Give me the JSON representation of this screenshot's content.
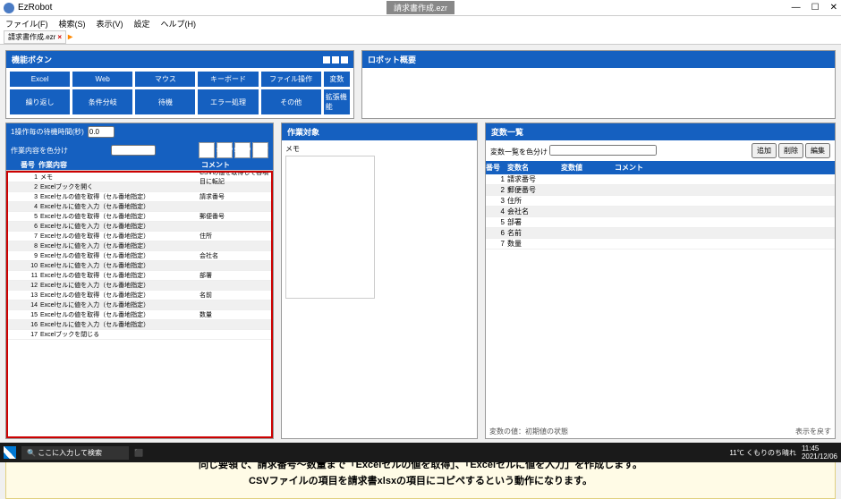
{
  "app": {
    "name": "EzRobot",
    "doc_title": "請求書作成.ezr"
  },
  "win_controls": {
    "min": "—",
    "max": "☐",
    "close": "✕"
  },
  "menu": [
    "ファイル(F)",
    "検索(S)",
    "表示(V)",
    "設定",
    "ヘルプ(H)"
  ],
  "tab": {
    "label": "請求書作成.ezr"
  },
  "func": {
    "title": "機能ボタン",
    "row1": [
      "Excel",
      "Web",
      "マウス",
      "キーボード",
      "ファイル操作",
      "変数"
    ],
    "row2": [
      "繰り返し",
      "条件分岐",
      "待機",
      "エラー処理",
      "その他",
      "拡張機能"
    ]
  },
  "robot": {
    "title": "ロボット概要"
  },
  "steps": {
    "wait_label": "1操作毎の待機時間(秒)",
    "wait_val": "0.0",
    "color_label": "作業内容を色分け",
    "hdr": [
      "",
      "番号",
      "作業内容",
      "コメント"
    ],
    "play": [
      "REC",
      "STEP",
      "STOP",
      "PLAY"
    ],
    "rows": [
      {
        "n": "1",
        "a": "メモ",
        "c": "CSVの値を取得して各項目に転記"
      },
      {
        "n": "2",
        "a": "Excelブックを開く",
        "c": ""
      },
      {
        "n": "3",
        "a": "Excelセルの値を取得（セル番地指定）",
        "c": "請求番号"
      },
      {
        "n": "4",
        "a": "Excelセルに値を入力（セル番地指定）",
        "c": ""
      },
      {
        "n": "5",
        "a": "Excelセルの値を取得（セル番地指定）",
        "c": "郵便番号"
      },
      {
        "n": "6",
        "a": "Excelセルに値を入力（セル番地指定）",
        "c": ""
      },
      {
        "n": "7",
        "a": "Excelセルの値を取得（セル番地指定）",
        "c": "住所"
      },
      {
        "n": "8",
        "a": "Excelセルに値を入力（セル番地指定）",
        "c": ""
      },
      {
        "n": "9",
        "a": "Excelセルの値を取得（セル番地指定）",
        "c": "会社名"
      },
      {
        "n": "10",
        "a": "Excelセルに値を入力（セル番地指定）",
        "c": ""
      },
      {
        "n": "11",
        "a": "Excelセルの値を取得（セル番地指定）",
        "c": "部署"
      },
      {
        "n": "12",
        "a": "Excelセルに値を入力（セル番地指定）",
        "c": ""
      },
      {
        "n": "13",
        "a": "Excelセルの値を取得（セル番地指定）",
        "c": "名前"
      },
      {
        "n": "14",
        "a": "Excelセルに値を入力（セル番地指定）",
        "c": ""
      },
      {
        "n": "15",
        "a": "Excelセルの値を取得（セル番地指定）",
        "c": "数量"
      },
      {
        "n": "16",
        "a": "Excelセルに値を入力（セル番地指定）",
        "c": ""
      },
      {
        "n": "17",
        "a": "Excelブックを閉じる",
        "c": ""
      }
    ]
  },
  "target": {
    "title": "作業対象",
    "memo": "メモ"
  },
  "vars": {
    "title": "変数一覧",
    "color_label": "変数一覧を色分け",
    "btns": [
      "追加",
      "削除",
      "編集"
    ],
    "hdr": [
      "番号",
      "変数名",
      "変数値",
      "コメント"
    ],
    "rows": [
      {
        "n": "1",
        "name": "請求番号"
      },
      {
        "n": "2",
        "name": "郵便番号"
      },
      {
        "n": "3",
        "name": "住所"
      },
      {
        "n": "4",
        "name": "会社名"
      },
      {
        "n": "5",
        "name": "部署"
      },
      {
        "n": "6",
        "name": "名前"
      },
      {
        "n": "7",
        "name": "数量"
      }
    ],
    "foot_l": "変数の値：初期値の状態",
    "foot_r": "表示を戻す"
  },
  "note": {
    "l1": "同じ要領で、請求番号〜数量まで「Excelセルの値を取得」、「Excelセルに値を入力」を作成します。",
    "l2": "CSVファイルの項目を請求書xlsxの項目にコピペするという動作になります。"
  },
  "taskbar": {
    "search_ph": "ここに入力して検索",
    "weather": "11℃ くもりのち晴れ",
    "time": "11:45",
    "date": "2021/12/06"
  }
}
